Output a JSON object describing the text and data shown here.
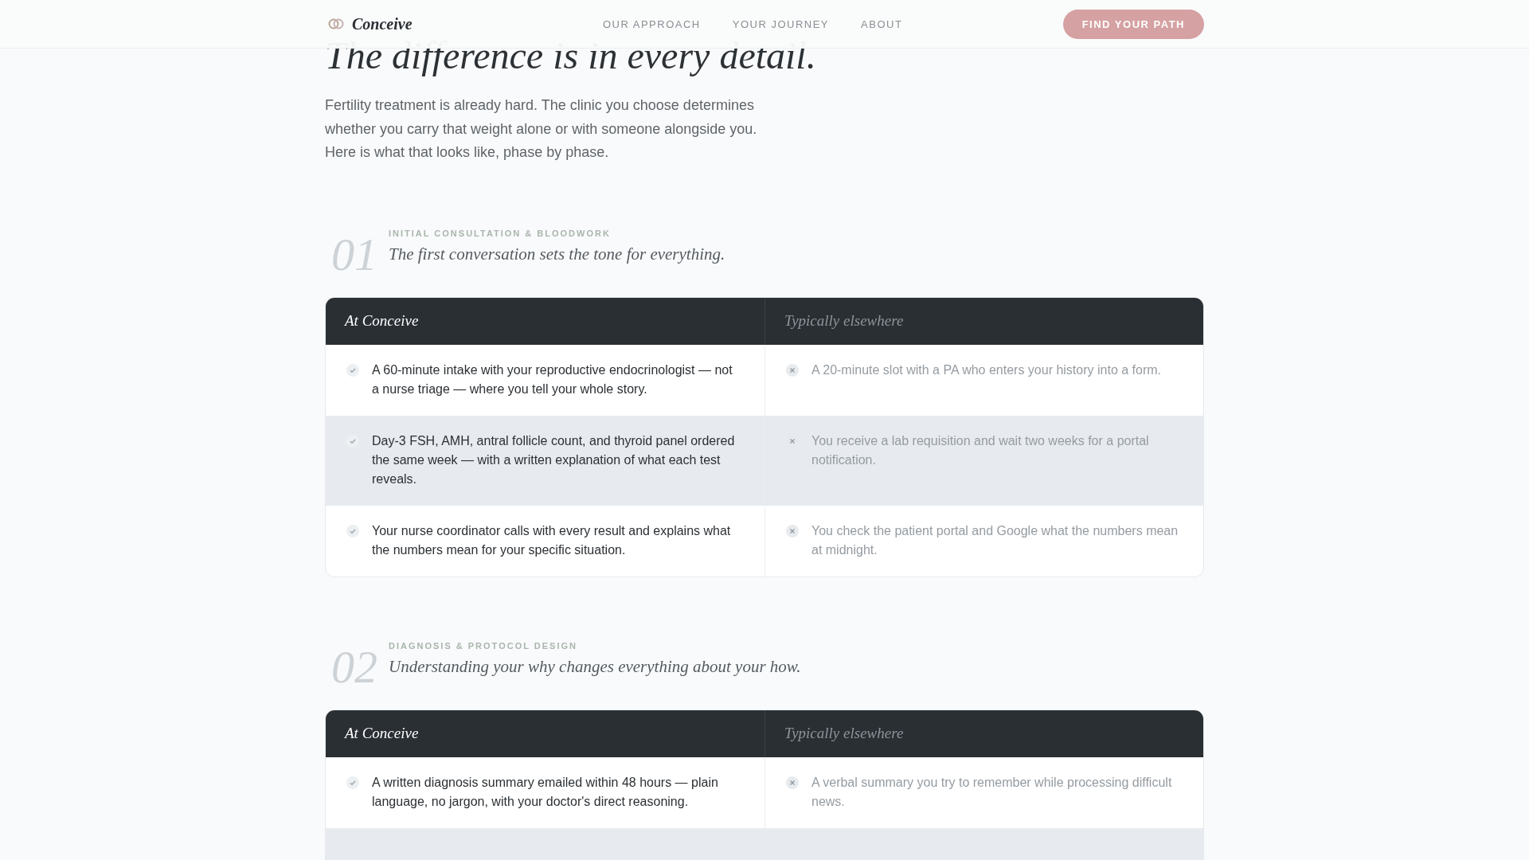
{
  "header": {
    "brand": "Conceive",
    "nav": [
      {
        "label": "OUR APPROACH"
      },
      {
        "label": "YOUR JOURNEY"
      },
      {
        "label": "ABOUT"
      }
    ],
    "cta": "FIND YOUR PATH"
  },
  "hero": {
    "title": "The difference is in every detail.",
    "intro": "Fertility treatment is already hard. The clinic you choose determines whether you carry that weight alone or with someone alongside you. Here is what that looks like, phase by phase."
  },
  "phases": [
    {
      "number": "01",
      "label": "INITIAL CONSULTATION & BLOODWORK",
      "subtitle": "The first conversation sets the tone for everything.",
      "columns": [
        "At Conceive",
        "Typically elsewhere"
      ],
      "rows": [
        {
          "ours": "A 60-minute intake with your reproductive endocrinologist — not a nurse triage — where you tell your whole story.",
          "theirs": "A 20-minute slot with a PA who enters your history into a form."
        },
        {
          "ours": "Day-3 FSH, AMH, antral follicle count, and thyroid panel ordered the same week — with a written explanation of what each test reveals.",
          "theirs": "You receive a lab requisition and wait two weeks for a portal notification."
        },
        {
          "ours": "Your nurse coordinator calls with every result and explains what the numbers mean for your specific situation.",
          "theirs": "You check the patient portal and Google what the numbers mean at midnight."
        }
      ]
    },
    {
      "number": "02",
      "label": "DIAGNOSIS & PROTOCOL DESIGN",
      "subtitle": "Understanding your why changes everything about your how.",
      "columns": [
        "At Conceive",
        "Typically elsewhere"
      ],
      "rows": [
        {
          "ours": "A written diagnosis summary emailed within 48 hours — plain language, no jargon, with your doctor's direct reasoning.",
          "theirs": "A verbal summary you try to remember while processing difficult news."
        }
      ]
    }
  ]
}
